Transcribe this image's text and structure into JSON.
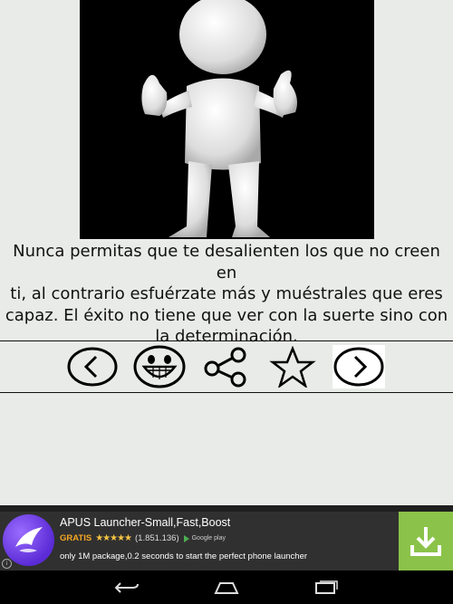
{
  "hero": {
    "image": "white-figure-thumbs-up"
  },
  "quote": {
    "lines": [
      "Nunca permitas que te desalienten los que no creen en",
      "ti, al contrario esfuérzate más y muéstrales que eres",
      "capaz. El éxito no tiene que ver con la suerte sino con",
      "la determinación."
    ]
  },
  "toolbar": {
    "buttons": [
      {
        "icon": "circle-chevron-left-icon"
      },
      {
        "icon": "laughing-smiley-icon"
      },
      {
        "icon": "share-icon"
      },
      {
        "icon": "star-outline-icon"
      },
      {
        "icon": "circle-chevron-right-icon"
      }
    ]
  },
  "ad": {
    "title": "APUS Launcher-Small,Fast,Boost",
    "price": "GRATIS",
    "stars": "★★★★★",
    "reviews": "(1.851.136)",
    "store": "Google play",
    "description": "only 1M package,0.2 seconds to start the perfect phone launcher",
    "info": "i",
    "colors": {
      "download": "#8bc34a",
      "logo": "#6a3cf0",
      "price": "#f5a623"
    }
  },
  "navbar": {
    "icons": [
      "back-icon",
      "home-icon",
      "recents-icon"
    ]
  }
}
